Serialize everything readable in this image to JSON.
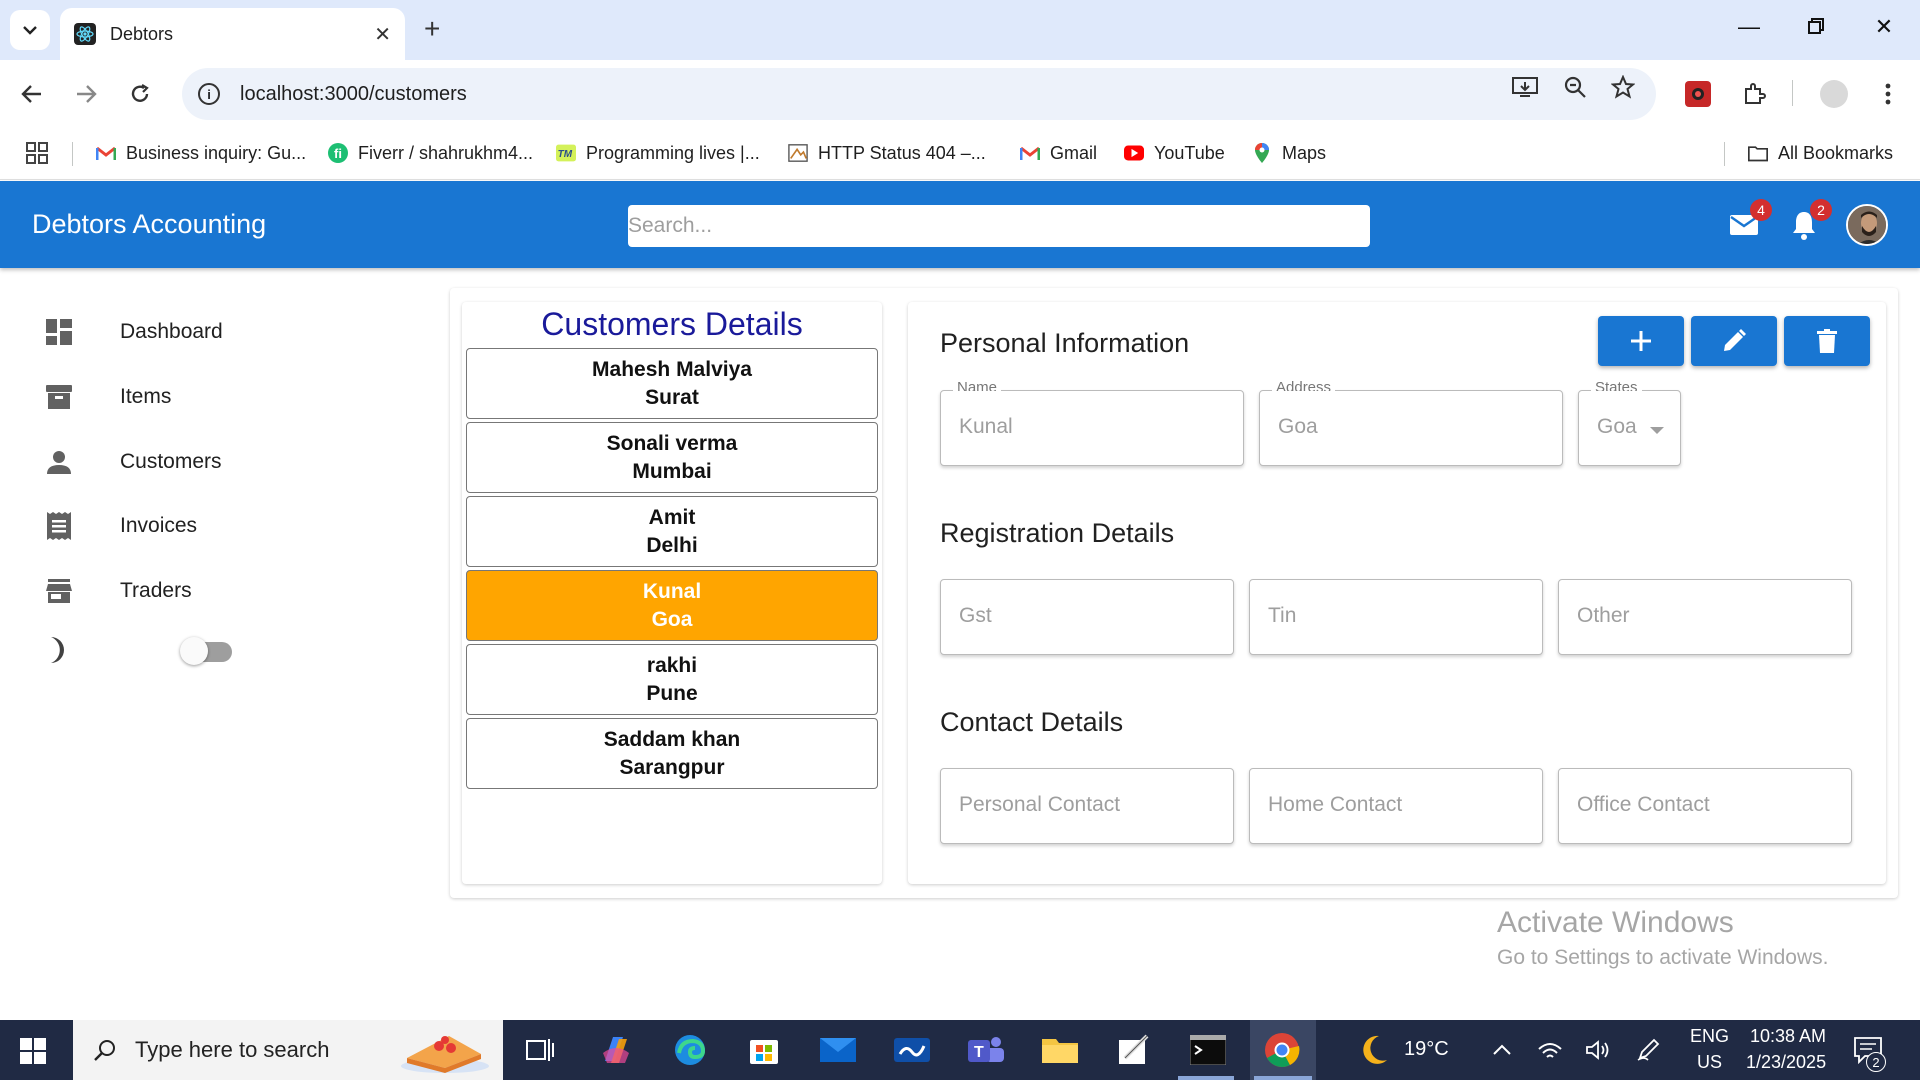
{
  "browser": {
    "tab_title": "Debtors",
    "url": "localhost:3000/customers",
    "bookmarks": [
      {
        "label": "Business inquiry: Gu...",
        "icon": "gmail-icon"
      },
      {
        "label": "Fiverr / shahrukhm4...",
        "icon": "fiverr-icon"
      },
      {
        "label": "Programming lives |...",
        "icon": "tm-icon"
      },
      {
        "label": "HTTP Status 404 –...",
        "icon": "page-icon"
      },
      {
        "label": "Gmail",
        "icon": "gmail-icon"
      },
      {
        "label": "YouTube",
        "icon": "youtube-icon"
      },
      {
        "label": "Maps",
        "icon": "maps-icon"
      }
    ],
    "all_bookmarks": "All Bookmarks"
  },
  "header": {
    "title": "Debtors Accounting",
    "search_placeholder": "Search...",
    "mail_count": "4",
    "notification_count": "2"
  },
  "sidebar": {
    "items": [
      {
        "label": "Dashboard",
        "icon": "dashboard-icon"
      },
      {
        "label": "Items",
        "icon": "archive-icon"
      },
      {
        "label": "Customers",
        "icon": "person-icon"
      },
      {
        "label": "Invoices",
        "icon": "receipt-icon"
      },
      {
        "label": "Traders",
        "icon": "store-icon"
      }
    ],
    "dark_mode_enabled": false
  },
  "customers": {
    "title": "Customers Details",
    "list": [
      {
        "name": "Mahesh Malviya",
        "city": "Surat",
        "selected": false
      },
      {
        "name": "Sonali verma",
        "city": "Mumbai",
        "selected": false
      },
      {
        "name": "Amit",
        "city": "Delhi",
        "selected": false
      },
      {
        "name": "Kunal",
        "city": "Goa",
        "selected": true
      },
      {
        "name": "rakhi",
        "city": "Pune",
        "selected": false
      },
      {
        "name": "Saddam khan",
        "city": "Sarangpur",
        "selected": false
      }
    ]
  },
  "details": {
    "personal_title": "Personal Information",
    "name_label": "Name",
    "name_value": "Kunal",
    "address_label": "Address",
    "address_value": "Goa",
    "states_label": "States",
    "states_value": "Goa",
    "registration_title": "Registration Details",
    "gst_placeholder": "Gst",
    "tin_placeholder": "Tin",
    "other_placeholder": "Other",
    "contact_title": "Contact Details",
    "personal_contact_placeholder": "Personal Contact",
    "home_contact_placeholder": "Home Contact",
    "office_contact_placeholder": "Office Contact"
  },
  "watermark": {
    "line1": "Activate Windows",
    "line2": "Go to Settings to activate Windows."
  },
  "taskbar": {
    "search_placeholder": "Type here to search",
    "weather": "19°C",
    "language": "ENG",
    "region": "US",
    "time": "10:38 AM",
    "date": "1/23/2025",
    "notifications": "2"
  },
  "colors": {
    "appbar": "#1976d2",
    "selected_customer": "#ffa500",
    "title_blue": "#1a1a9a"
  }
}
